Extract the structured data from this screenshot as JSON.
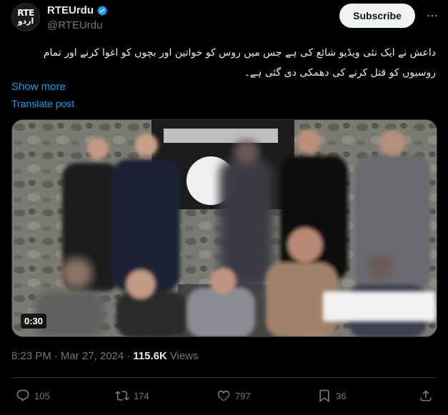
{
  "header": {
    "avatar_line1": "RTE",
    "avatar_line2": "اردو",
    "display_name": "RTEUrdu",
    "handle": "@RTEUrdu",
    "subscribe_label": "Subscribe",
    "more_icon": "more-horizontal-icon"
  },
  "post": {
    "text": "داعش نے ایک نئی ویڈیو شائع کی ہے جس میں روس کو خواتین اور بچوں کو اغوا کرنے اور تمام روسیوں کو قتل کرنے کی دھمکی دی گئی ہے۔",
    "show_more": "Show more",
    "translate": "Translate post"
  },
  "media": {
    "duration": "0:30"
  },
  "meta": {
    "time": "8:23 PM",
    "separator": "·",
    "date": "Mar 27, 2024",
    "separator2": "·",
    "views_count": "115.6K",
    "views_label": "Views"
  },
  "actions": {
    "replies": "105",
    "reposts": "174",
    "likes": "797",
    "bookmarks": "36"
  },
  "colors": {
    "accent": "#1d9bf0",
    "background": "#000000",
    "text": "#e7e9ea",
    "muted": "#71767b"
  }
}
